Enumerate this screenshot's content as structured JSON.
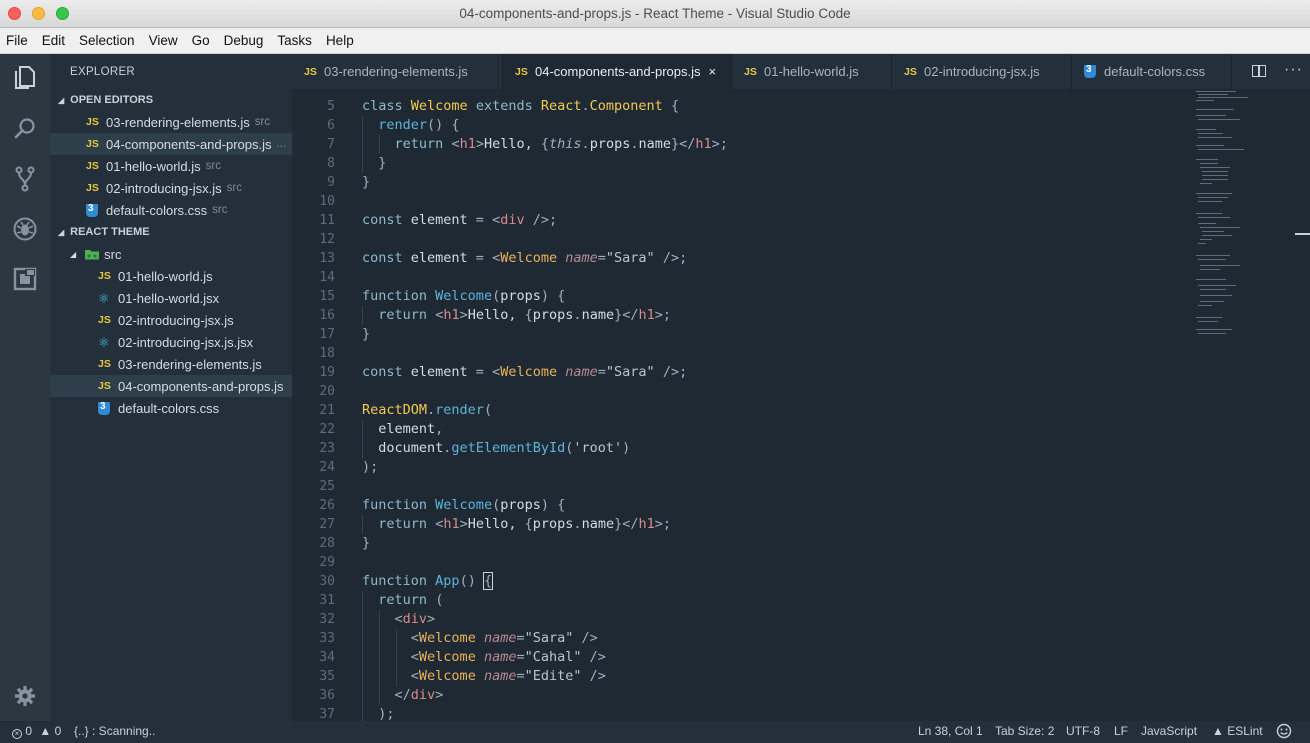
{
  "window": {
    "title": "04-components-and-props.js - React Theme - Visual Studio Code"
  },
  "menu": [
    "File",
    "Edit",
    "Selection",
    "View",
    "Go",
    "Debug",
    "Tasks",
    "Help"
  ],
  "sidebar": {
    "title": "EXPLORER",
    "open_editors": {
      "label": "OPEN EDITORS",
      "items": [
        {
          "name": "03-rendering-elements.js",
          "desc": "src",
          "type": "js"
        },
        {
          "name": "04-components-and-props.js",
          "desc": "...",
          "type": "js"
        },
        {
          "name": "01-hello-world.js",
          "desc": "src",
          "type": "js"
        },
        {
          "name": "02-introducing-jsx.js",
          "desc": "src",
          "type": "js"
        },
        {
          "name": "default-colors.css",
          "desc": "src",
          "type": "css"
        }
      ]
    },
    "project": {
      "label": "REACT THEME",
      "folder": "src",
      "items": [
        {
          "name": "01-hello-world.js",
          "type": "js"
        },
        {
          "name": "01-hello-world.jsx",
          "type": "react"
        },
        {
          "name": "02-introducing-jsx.js",
          "type": "js"
        },
        {
          "name": "02-introducing-jsx.js.jsx",
          "type": "react"
        },
        {
          "name": "03-rendering-elements.js",
          "type": "js"
        },
        {
          "name": "04-components-and-props.js",
          "type": "js"
        },
        {
          "name": "default-colors.css",
          "type": "css"
        }
      ]
    }
  },
  "tabs": [
    {
      "label": "03-rendering-elements.js",
      "type": "js"
    },
    {
      "label": "04-components-and-props.js",
      "type": "js",
      "active": true
    },
    {
      "label": "01-hello-world.js",
      "type": "js"
    },
    {
      "label": "02-introducing-jsx.js",
      "type": "js"
    },
    {
      "label": "default-colors.css",
      "type": "css"
    }
  ],
  "icons": {
    "js": "JS",
    "tab_close": "×",
    "tree_expanded": "◢",
    "react": "⚛"
  },
  "editor": {
    "line_numbers": [
      "5",
      "6",
      "7",
      "8",
      "9",
      "10",
      "11",
      "12",
      "13",
      "14",
      "15",
      "16",
      "17",
      "18",
      "19",
      "20",
      "21",
      "22",
      "23",
      "24",
      "25",
      "26",
      "27",
      "28",
      "29",
      "30",
      "31",
      "32",
      "33",
      "34",
      "35",
      "36",
      "37"
    ]
  },
  "statusbar": {
    "errors": "0",
    "warnings": "0",
    "scanning": "{..} : Scanning..",
    "position": "Ln 38, Col 1",
    "tab_size": "Tab Size: 2",
    "encoding": "UTF-8",
    "eol": "LF",
    "language": "JavaScript",
    "linter": "ESLint"
  },
  "colors": {
    "editor_bg": "#1e2933",
    "sidebar_bg": "#23303b",
    "activity_bg": "#2b3741",
    "js_badge": "#e8c63f",
    "css_badge": "#2f8ad8",
    "react_badge": "#4bc6e3"
  }
}
